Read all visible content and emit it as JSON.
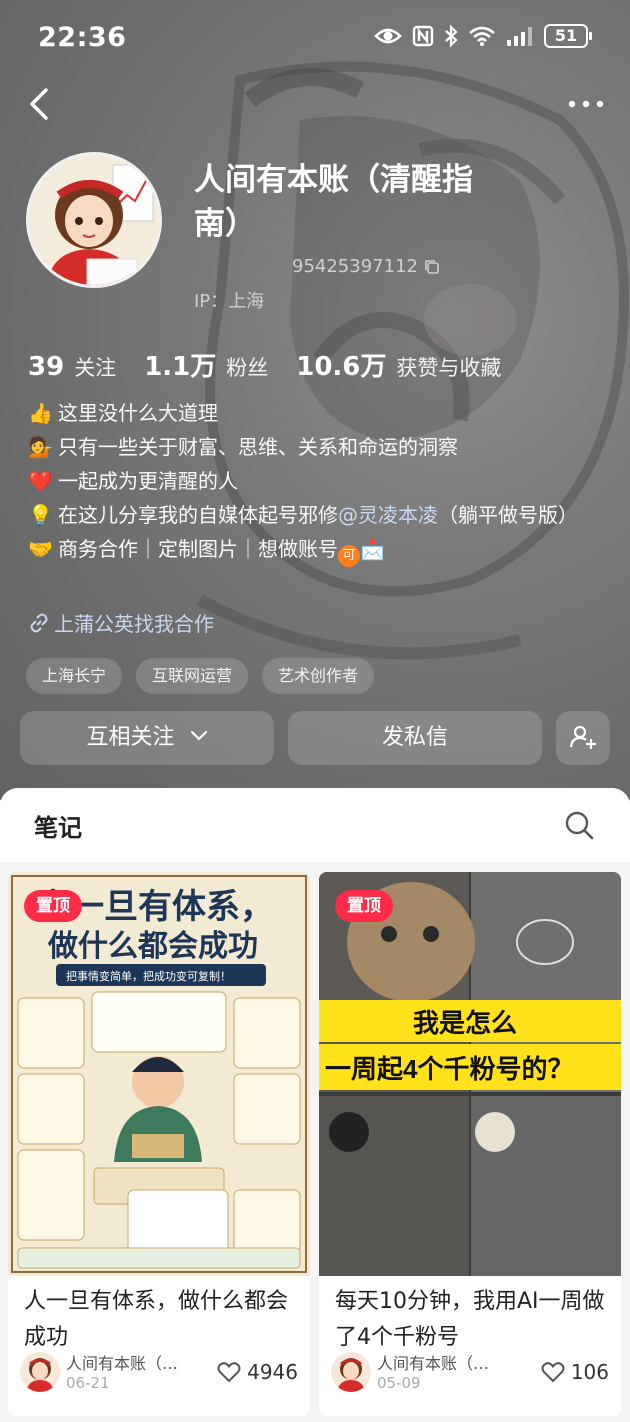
{
  "status_bar": {
    "time": "22:36",
    "battery": "51"
  },
  "profile": {
    "name": "人间有本账（清醒指南）",
    "user_id": "95425397112",
    "ip": "IP：上海"
  },
  "stats": [
    {
      "num": "39",
      "label": "关注"
    },
    {
      "num": "1.1万",
      "label": "粉丝"
    },
    {
      "num": "10.6万",
      "label": "获赞与收藏"
    }
  ],
  "bio": {
    "line1_emoji": "👍",
    "line1": "这里没什么大道理",
    "line2_emoji": "💁",
    "line2": "只有一些关于财富、思维、关系和命运的洞察",
    "line3_emoji": "❤️",
    "line3": "一起成为更清醒的人",
    "line4_emoji": "💡",
    "line4_pre": "在这儿分享我的自媒体起号邪修",
    "line4_mention": "@灵凌本凌",
    "line4_post": "（躺平做号版）",
    "line5_emoji": "🤝",
    "line5": "商务合作｜定制图片｜想做账号",
    "line5_chip": "可",
    "line5_end": "📩"
  },
  "collab_link": "上蒲公英找我合作",
  "tags": [
    "上海长宁",
    "互联网运营",
    "艺术创作者"
  ],
  "actions": {
    "follow": "互相关注",
    "message": "发私信"
  },
  "notes": {
    "tab": "笔记",
    "cards": [
      {
        "pin": "置顶",
        "thumb_title_line1": "人一旦有体系，",
        "thumb_title_line2": "做什么都会成功",
        "thumb_subtitle": "把事情变简单，把成功变可复制！",
        "title": "人一旦有体系，做什么都会成功",
        "author": "人间有本账（…",
        "date": "06-21",
        "likes": "4946"
      },
      {
        "pin": "置顶",
        "thumb_banner_line1": "我是怎么",
        "thumb_banner_line2": "一周起4个千粉号的？",
        "title": "每天10分钟，我用AI一周做了4个千粉号",
        "author": "人间有本账（…",
        "date": "05-09",
        "likes": "106"
      }
    ]
  },
  "colors": {
    "accent": "#ff2b47",
    "banner_yellow": "#ffe21a"
  }
}
